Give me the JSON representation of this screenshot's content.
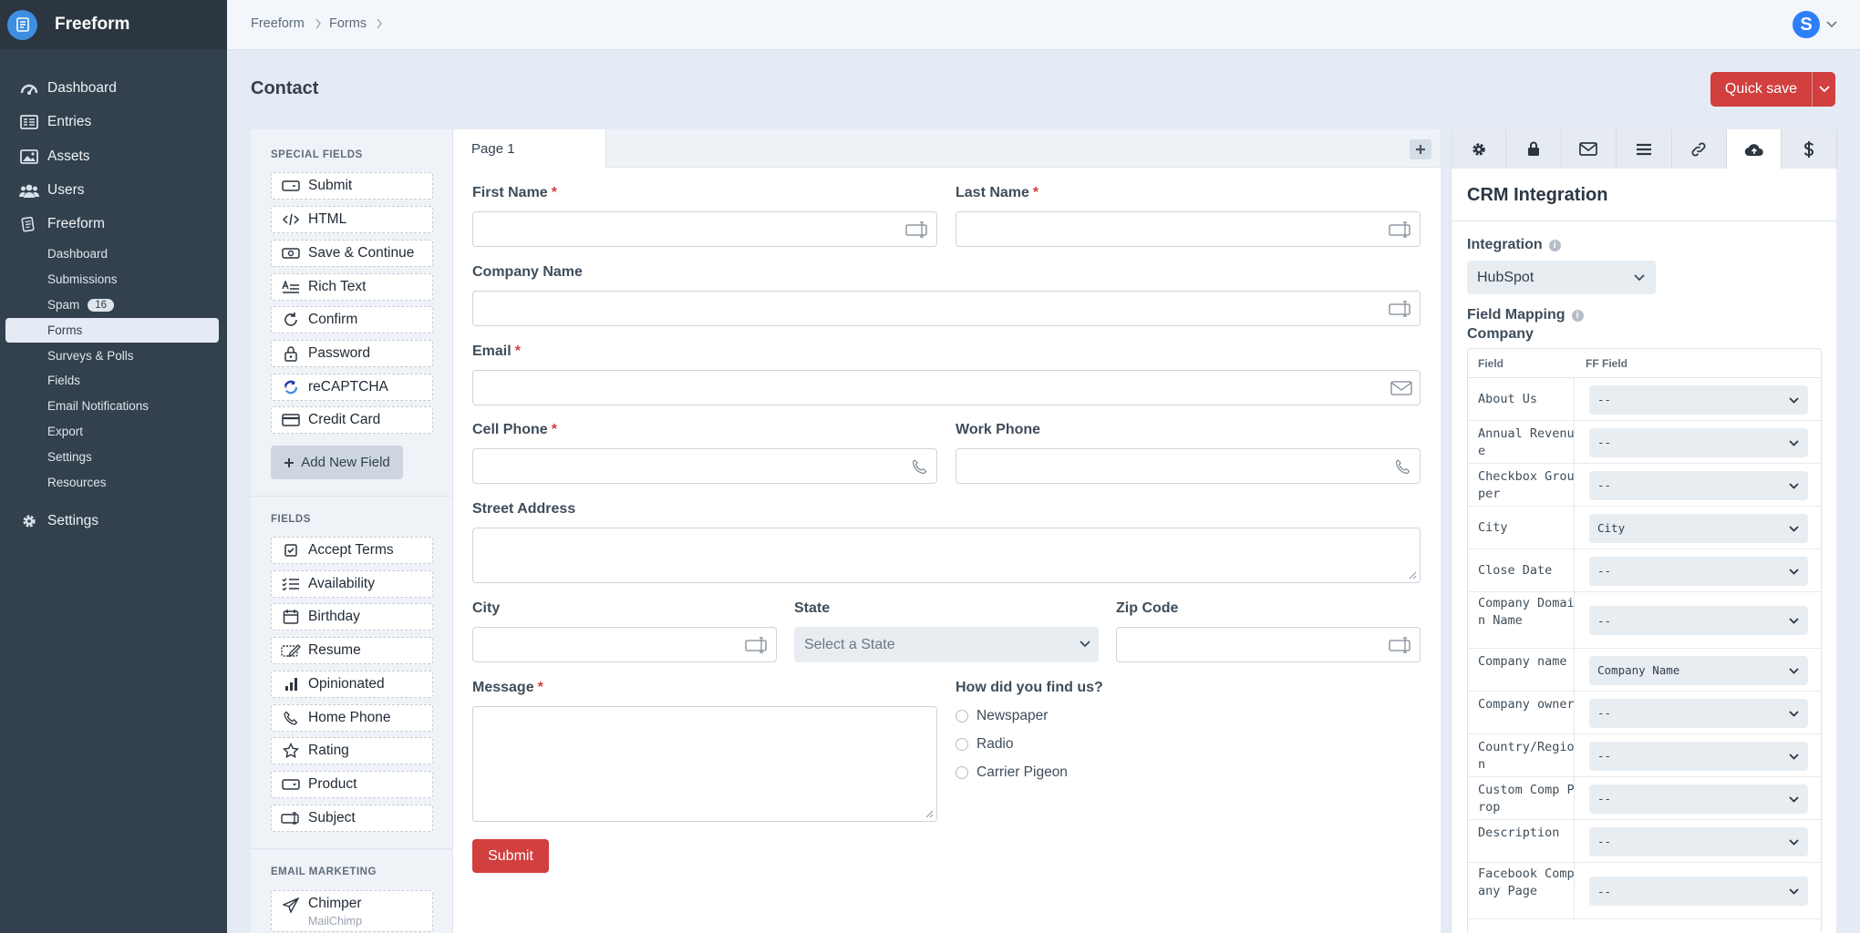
{
  "app": {
    "name": "Freeform"
  },
  "sidebar": {
    "main": [
      {
        "label": "Dashboard",
        "icon": "gauge-icon"
      },
      {
        "label": "Entries",
        "icon": "entries-icon"
      },
      {
        "label": "Assets",
        "icon": "image-icon"
      },
      {
        "label": "Users",
        "icon": "users-icon"
      },
      {
        "label": "Freeform",
        "icon": "freeform-icon"
      }
    ],
    "sub": [
      {
        "label": "Dashboard"
      },
      {
        "label": "Submissions"
      },
      {
        "label": "Spam",
        "badge": "16"
      },
      {
        "label": "Forms",
        "selected": true
      },
      {
        "label": "Surveys & Polls"
      },
      {
        "label": "Fields"
      },
      {
        "label": "Email Notifications"
      },
      {
        "label": "Export"
      },
      {
        "label": "Settings"
      },
      {
        "label": "Resources"
      }
    ],
    "settings": {
      "label": "Settings",
      "icon": "gear-icon"
    }
  },
  "breadcrumb": [
    "Freeform",
    "Forms"
  ],
  "user": {
    "initial": "S",
    "color": "#2d7ff9"
  },
  "page": {
    "title": "Contact",
    "quick_save": "Quick save"
  },
  "palette": {
    "special_heading": "SPECIAL FIELDS",
    "special": [
      {
        "label": "Submit",
        "icon": "submit-icon"
      },
      {
        "label": "HTML",
        "icon": "code-icon"
      },
      {
        "label": "Save & Continue",
        "icon": "save-continue-icon"
      },
      {
        "label": "Rich Text",
        "icon": "rich-text-icon"
      },
      {
        "label": "Confirm",
        "icon": "confirm-icon"
      },
      {
        "label": "Password",
        "icon": "lock-icon"
      },
      {
        "label": "reCAPTCHA",
        "icon": "recaptcha-icon"
      },
      {
        "label": "Credit Card",
        "icon": "credit-card-icon"
      }
    ],
    "add_new_field": "Add New Field",
    "fields_heading": "FIELDS",
    "fields": [
      {
        "label": "Accept Terms",
        "icon": "checkbox-icon"
      },
      {
        "label": "Availability",
        "icon": "checklist-icon"
      },
      {
        "label": "Birthday",
        "icon": "calendar-icon"
      },
      {
        "label": "Resume",
        "icon": "file-upload-icon"
      },
      {
        "label": "Opinionated",
        "icon": "bar-chart-icon"
      },
      {
        "label": "Home Phone",
        "icon": "phone-icon"
      },
      {
        "label": "Rating",
        "icon": "star-icon"
      },
      {
        "label": "Product",
        "icon": "dropdown-icon"
      },
      {
        "label": "Subject",
        "icon": "text-input-icon"
      }
    ],
    "email_heading": "EMAIL MARKETING",
    "email": [
      {
        "label": "Chimper",
        "sub": "MailChimp",
        "icon": "paper-plane-icon"
      }
    ]
  },
  "form": {
    "page_tab": "Page 1",
    "first_name": "First Name",
    "last_name": "Last Name",
    "company_name": "Company Name",
    "email": "Email",
    "cell_phone": "Cell Phone",
    "work_phone": "Work Phone",
    "street_address": "Street Address",
    "city": "City",
    "state": "State",
    "state_placeholder": "Select a State",
    "zip_code": "Zip Code",
    "message": "Message",
    "how_found": "How did you find us?",
    "radio_options": [
      "Newspaper",
      "Radio",
      "Carrier Pigeon"
    ],
    "submit": "Submit",
    "required_mark": "*"
  },
  "crm": {
    "tabs": [
      "settings-icon",
      "lock-icon",
      "mail-icon",
      "list-icon",
      "link-icon",
      "cloud-upload-icon",
      "dollar-icon"
    ],
    "selected_tab": 5,
    "title": "CRM Integration",
    "integration_label": "Integration",
    "integration_value": "HubSpot",
    "mapping_label": "Field Mapping",
    "mapping_sub": "Company",
    "col_field": "Field",
    "col_ff_field": "FF Field",
    "rows": [
      {
        "field": "About Us",
        "value": "--"
      },
      {
        "field": "Annual Revenue",
        "value": "--"
      },
      {
        "field": "Checkbox Grouper",
        "value": "--"
      },
      {
        "field": "City",
        "value": "City"
      },
      {
        "field": "Close Date",
        "value": "--"
      },
      {
        "field": "Company Domain Name",
        "value": "--"
      },
      {
        "field": "Company name",
        "value": "Company Name"
      },
      {
        "field": "Company owner",
        "value": "--"
      },
      {
        "field": "Country/Region",
        "value": "--"
      },
      {
        "field": "Custom Comp Prop",
        "value": "--"
      },
      {
        "field": "Description",
        "value": "--"
      },
      {
        "field": "Facebook Company Page",
        "value": "--"
      }
    ]
  },
  "colors": {
    "accent": "#d13f3f",
    "sidebar": "#33404d",
    "brand_logo": "#3d8ee0"
  }
}
